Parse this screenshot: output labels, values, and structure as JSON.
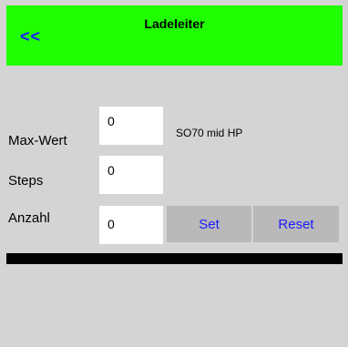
{
  "header": {
    "back_label": "<<",
    "title": "Ladeleiter"
  },
  "form": {
    "max_wert_label": "Max-Wert",
    "max_wert_value": "0",
    "steps_label": "Steps",
    "steps_value": "0",
    "anzahl_label": "Anzahl",
    "anzahl_value": "0",
    "device_note": "SO70 mid HP"
  },
  "actions": {
    "set_label": "Set",
    "reset_label": "Reset"
  },
  "colors": {
    "header_bg": "#1fff00",
    "link_blue": "#1a1aff",
    "page_bg": "#d4d4d4",
    "button_bg": "#b9b9b9"
  }
}
